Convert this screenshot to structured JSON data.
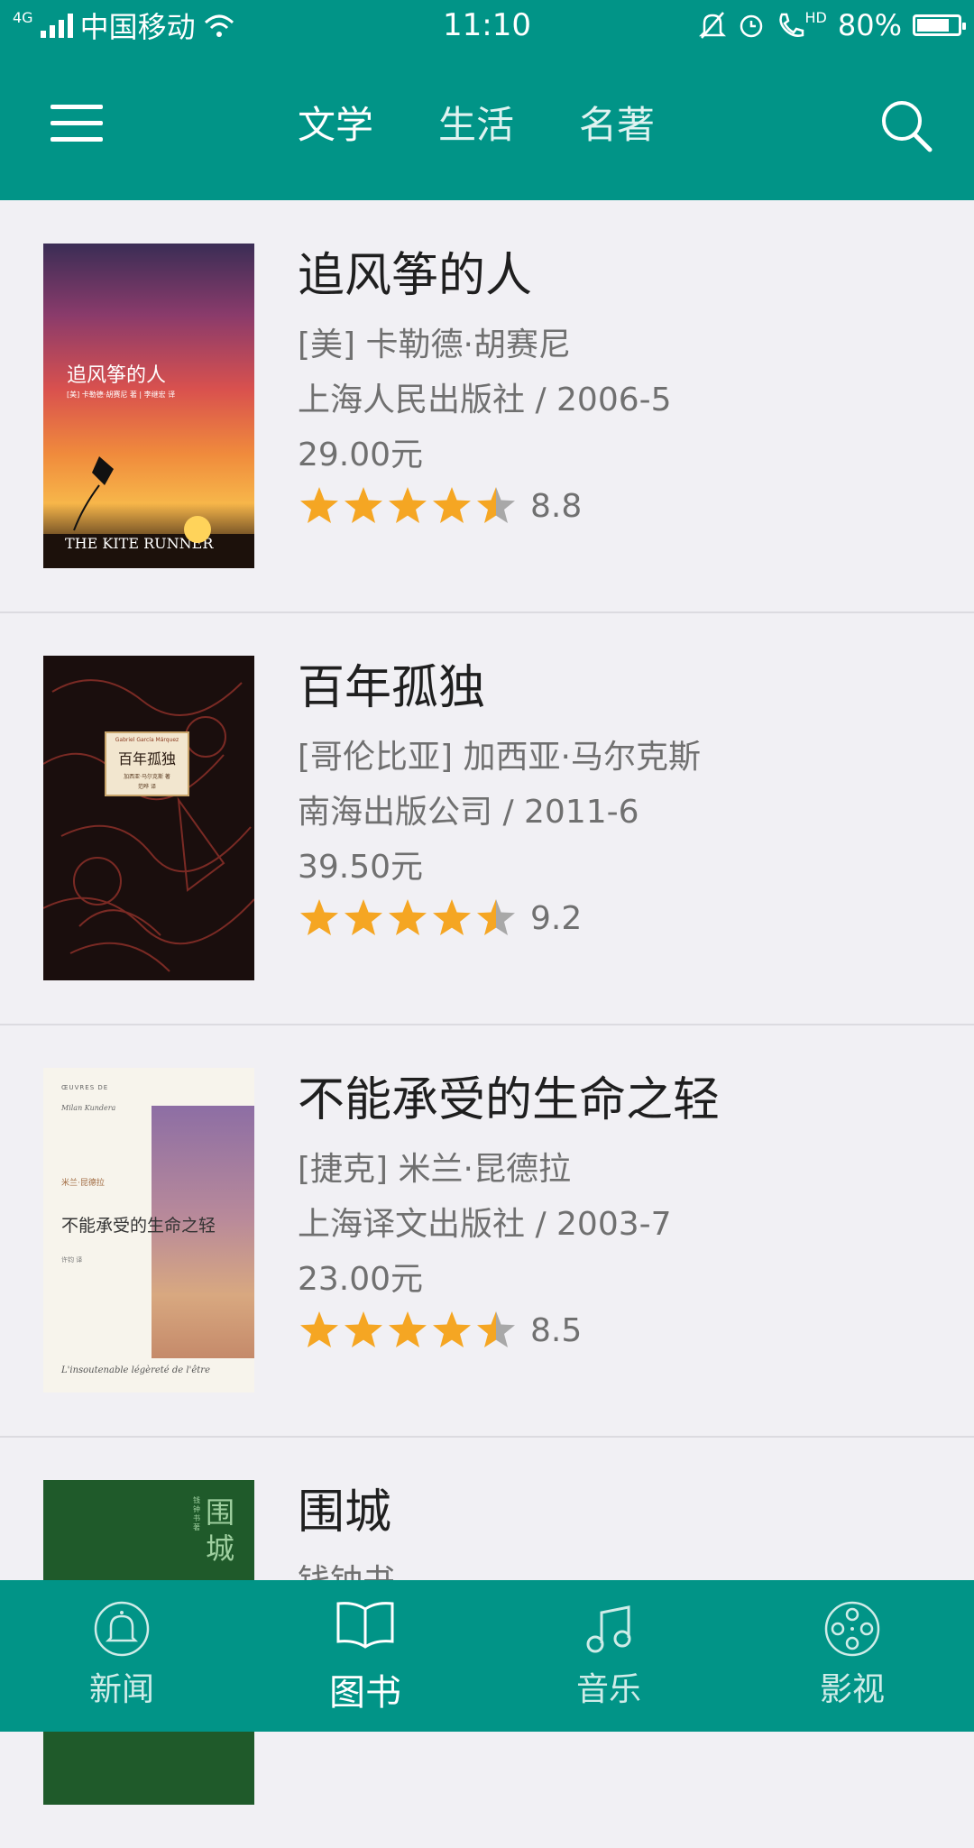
{
  "status": {
    "carrier": "中国移动",
    "network": "4G",
    "time": "11:10",
    "hd": "HD",
    "battery": "80%",
    "battery_level": 0.8
  },
  "header": {
    "tabs": [
      {
        "label": "文学"
      },
      {
        "label": "生活"
      },
      {
        "label": "名著"
      }
    ]
  },
  "colors": {
    "primary": "#019487",
    "star": "#f5a623",
    "star_empty": "#a8a8a8"
  },
  "books": [
    {
      "title": "追风筝的人",
      "author": "[美] 卡勒德·胡赛尼",
      "publisher": "上海人民出版社 / 2006-5",
      "price": "29.00元",
      "score": "8.8",
      "stars": 4.5,
      "cover": {
        "title": "追风筝的人",
        "subtitle": "[美] 卡勒德·胡赛尼 著 | 李继宏 译",
        "english": "THE KITE RUNNER"
      }
    },
    {
      "title": "百年孤独",
      "author": "[哥伦比亚] 加西亚·马尔克斯",
      "publisher": "南海出版公司 / 2011-6",
      "price": "39.50元",
      "score": "9.2",
      "stars": 4.5,
      "cover": {
        "header": "Gabriel García Márquez",
        "title": "百年孤独",
        "subtitle": "加西亚·马尔克斯 著",
        "subtitle2": "范晔 译"
      }
    },
    {
      "title": "不能承受的生命之轻",
      "author": "[捷克] 米兰·昆德拉",
      "publisher": "上海译文出版社 / 2003-7",
      "price": "23.00元",
      "score": "8.5",
      "stars": 4.5,
      "cover": {
        "top1": "ŒUVRES DE",
        "top2": "Milan Kundera",
        "author": "米兰·昆德拉",
        "title": "不能承受的生命之轻",
        "translator": "许钧 译",
        "bottom": "L'insoutenable légèreté de l'être"
      }
    },
    {
      "title": "围城",
      "author": "钱钟书",
      "cover": {
        "title": "围城",
        "side": "钱钟书 著"
      }
    }
  ],
  "bottom_nav": [
    {
      "label": "新闻",
      "icon": "bell-icon"
    },
    {
      "label": "图书",
      "icon": "book-icon",
      "active": true
    },
    {
      "label": "音乐",
      "icon": "music-icon"
    },
    {
      "label": "影视",
      "icon": "film-reel-icon"
    }
  ]
}
